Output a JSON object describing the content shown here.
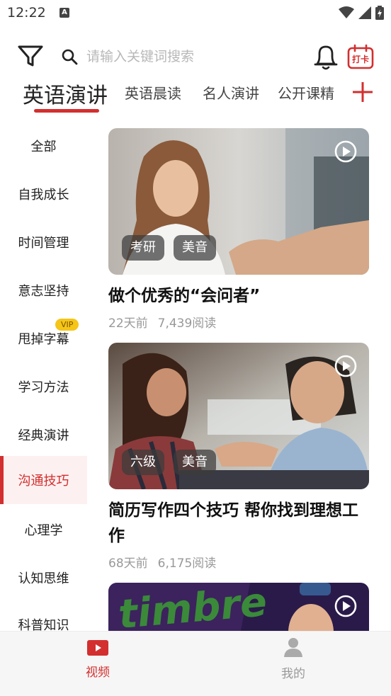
{
  "status_bar": {
    "time": "12:22"
  },
  "header": {
    "search_placeholder": "请输入关键词搜索",
    "checkin_label": "打卡"
  },
  "tabs": [
    {
      "label": "英语演讲",
      "active": true
    },
    {
      "label": "英语晨读",
      "active": false
    },
    {
      "label": "名人演讲",
      "active": false
    },
    {
      "label": "公开课精",
      "active": false
    }
  ],
  "sidebar": {
    "items": [
      {
        "label": "全部"
      },
      {
        "label": "自我成长"
      },
      {
        "label": "时间管理"
      },
      {
        "label": "意志坚持"
      },
      {
        "label": "甩掉字幕",
        "badge": "VIP"
      },
      {
        "label": "学习方法"
      },
      {
        "label": "经典演讲"
      },
      {
        "label": "沟通技巧",
        "active": true
      },
      {
        "label": "心理学"
      },
      {
        "label": "认知思维"
      },
      {
        "label": "科普知识"
      }
    ]
  },
  "cards": [
    {
      "tags": [
        "考研",
        "美音"
      ],
      "title": "做个优秀的“会问者”",
      "time": "22天前",
      "reads": "7,439阅读"
    },
    {
      "tags": [
        "六级",
        "美音"
      ],
      "title": "简历写作四个技巧 帮你找到理想工作",
      "time": "68天前",
      "reads": "6,175阅读"
    },
    {
      "image_text": "timbre"
    }
  ],
  "bottom_nav": [
    {
      "label": "视频",
      "active": true
    },
    {
      "label": "我的",
      "active": false
    }
  ],
  "colors": {
    "accent": "#d32f2f",
    "vip": "#f5c518"
  }
}
